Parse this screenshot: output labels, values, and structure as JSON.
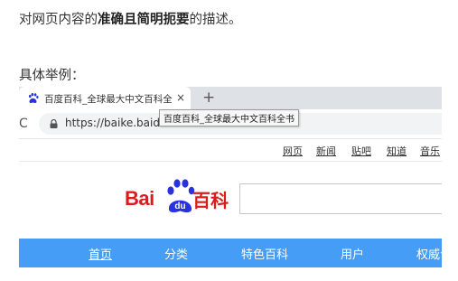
{
  "intro": {
    "prefix": "对网页内容的",
    "emphasis": "准确且简明扼要",
    "suffix": "的描述。"
  },
  "example_label": "具体举例：",
  "browser": {
    "tab": {
      "title": "百度百科_全球最大中文百科全书",
      "favicon": "baidu-paw-icon",
      "close_symbol": "×"
    },
    "new_tab_symbol": "+",
    "reload_symbol": "C",
    "url": "https://baike.baidu.com",
    "tooltip": "百度百科_全球最大中文百科全书"
  },
  "page": {
    "top_nav": [
      "网页",
      "新闻",
      "贴吧",
      "知道",
      "音乐"
    ],
    "logo": {
      "bai": "Bai",
      "du": "du",
      "baike": "百科"
    },
    "main_nav": [
      {
        "label": "首页",
        "active": true
      },
      {
        "label": "分类",
        "active": false
      },
      {
        "label": "特色百科",
        "active": false
      },
      {
        "label": "用户",
        "active": false
      },
      {
        "label": "权威合作",
        "active": false
      }
    ]
  },
  "colors": {
    "baidu_red": "#de1a1a",
    "baidu_blue": "#2932e1",
    "nav_blue": "#459df5",
    "tab_strip": "#dee1e6"
  }
}
